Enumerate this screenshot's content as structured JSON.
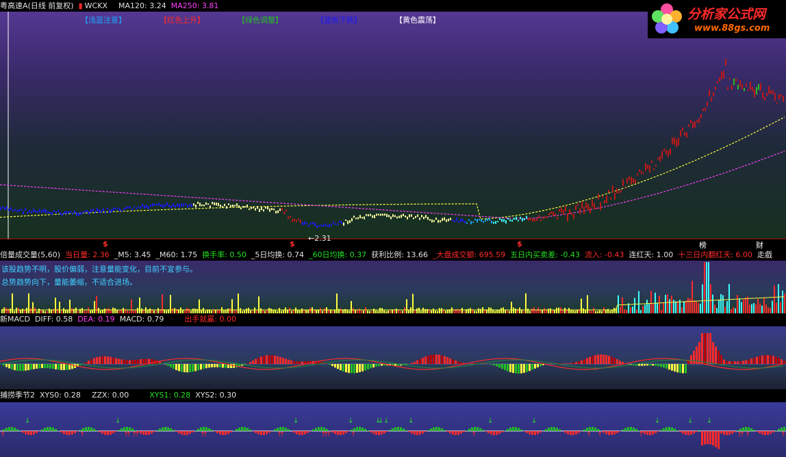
{
  "main_header": {
    "stock": "粤高速A(日线 前复权)",
    "indicator": "WCKX",
    "ma120": "MA120: 3.24",
    "ma250": "MA250: 3.81"
  },
  "legend_tags": [
    "【浅蓝注意】",
    "【红色上升】",
    "【绿色调整】",
    "【蓝色下跌】",
    "【黄色震荡】"
  ],
  "legend_colors": [
    "#1aa8ff",
    "#ff2a2a",
    "#24c024",
    "#1a1aff",
    "#ffff40"
  ],
  "price_annotation": "←2.31",
  "markers": {
    "s1": "$",
    "s2": "$",
    "s3": "$",
    "bang": "榜",
    "cai": "财"
  },
  "logo": {
    "title": "分析家公式网",
    "url": "www.88gs.com"
  },
  "volume_header": {
    "name": "倍量成交量(5,60)",
    "today": "当日量: 2.36",
    "m5": "_M5: 3.45",
    "m60": "_M60: 1.75",
    "turnover": "换手率: 0.50",
    "avg5": "_5日均换: 0.74",
    "avg60": "_60日均换: 0.37",
    "profit": "获利比例: 13.66",
    "market": "_大盘成交额: 695.59",
    "diff5": "五日内买卖差: -0.43",
    "inflow": "流入: -0.43",
    "red_days": "连红天: 1.00",
    "red13": "十三日内翻红天: 6.00",
    "trend": "走戲"
  },
  "volume_notes": [
    "该股趋势不明，股价偏弱，注意量能变化，目前不宜参与。",
    "总势趋势向下，量能萎缩，不适合进场。"
  ],
  "macd_header": {
    "name": "新MACD",
    "diff": "DIFF: 0.58",
    "dea": "DEA: 0.19",
    "macd": "MACD: 0.79",
    "signal": "出手就赢: 0.00"
  },
  "season_header": {
    "name": "捕捞季节2",
    "xys0": "XYS0: 0.28",
    "zzx": "ZZX: 0.00",
    "xys1": "XYS1: 0.28",
    "xys2": "XYS2: 0.30"
  },
  "colors": {
    "up": "#ff2a2a",
    "down": "#24c024",
    "ma120_line": "#ffff40",
    "ma250_line": "#ff40ff",
    "cyan": "#3fd3ff"
  }
}
